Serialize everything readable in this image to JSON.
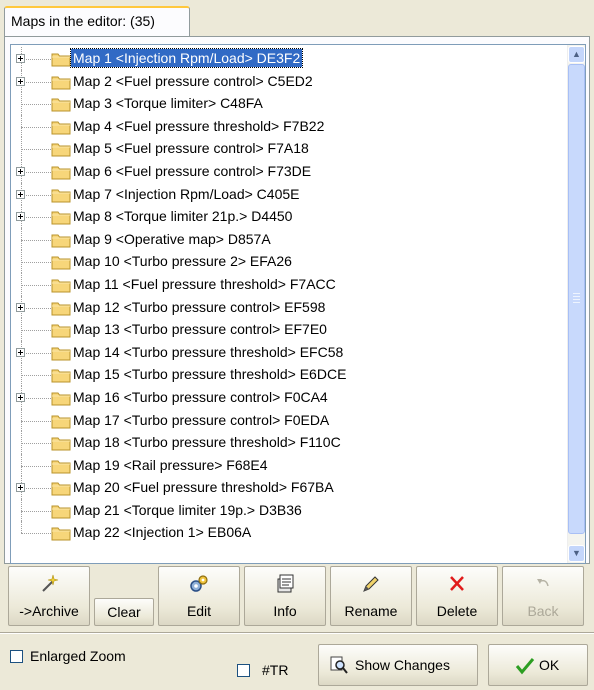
{
  "tab": {
    "label": "Maps in the editor: (35)"
  },
  "maps": [
    {
      "label": "Map 1 <Injection  Rpm/Load>  DE3F2",
      "expandable": true,
      "selected": true
    },
    {
      "label": "Map 2 <Fuel pressure control>  C5ED2",
      "expandable": true,
      "selected": false
    },
    {
      "label": "Map 3 <Torque limiter>  C48FA",
      "expandable": false,
      "selected": false
    },
    {
      "label": "Map 4 <Fuel pressure threshold>  F7B22",
      "expandable": false,
      "selected": false
    },
    {
      "label": "Map 5 <Fuel pressure control>  F7A18",
      "expandable": false,
      "selected": false
    },
    {
      "label": "Map 6 <Fuel pressure control>  F73DE",
      "expandable": true,
      "selected": false
    },
    {
      "label": "Map 7 <Injection  Rpm/Load>  C405E",
      "expandable": true,
      "selected": false
    },
    {
      "label": "Map 8 <Torque limiter 21p.>  D4450",
      "expandable": true,
      "selected": false
    },
    {
      "label": "Map 9 <Operative map>  D857A",
      "expandable": false,
      "selected": false
    },
    {
      "label": "Map 10 <Turbo pressure 2>  EFA26",
      "expandable": false,
      "selected": false
    },
    {
      "label": "Map 11 <Fuel pressure threshold>  F7ACC",
      "expandable": false,
      "selected": false
    },
    {
      "label": "Map 12 <Turbo pressure control>  EF598",
      "expandable": true,
      "selected": false
    },
    {
      "label": "Map 13 <Turbo pressure control>  EF7E0",
      "expandable": false,
      "selected": false
    },
    {
      "label": "Map 14 <Turbo pressure threshold>  EFC58",
      "expandable": true,
      "selected": false
    },
    {
      "label": "Map 15 <Turbo pressure threshold>  E6DCE",
      "expandable": false,
      "selected": false
    },
    {
      "label": "Map 16 <Turbo pressure control>  F0CA4",
      "expandable": true,
      "selected": false
    },
    {
      "label": "Map 17 <Turbo pressure control>  F0EDA",
      "expandable": false,
      "selected": false
    },
    {
      "label": "Map 18 <Turbo pressure threshold>  F110C",
      "expandable": false,
      "selected": false
    },
    {
      "label": "Map 19 <Rail pressure>  F68E4",
      "expandable": false,
      "selected": false
    },
    {
      "label": "Map 20 <Fuel pressure threshold>  F67BA",
      "expandable": true,
      "selected": false
    },
    {
      "label": "Map 21 <Torque limiter 19p.>  D3B36",
      "expandable": false,
      "selected": false
    },
    {
      "label": "Map 22 <Injection 1>  EB06A",
      "expandable": false,
      "selected": false
    }
  ],
  "toolbar": {
    "archive": "->Archive",
    "clear": "Clear",
    "edit": "Edit",
    "info": "Info",
    "rename": "Rename",
    "delete": "Delete",
    "back": "Back"
  },
  "icons": {
    "archive": "wand-icon",
    "edit": "gears-icon",
    "info": "info-icon",
    "rename": "pencil-icon",
    "delete": "red-x-icon",
    "back": "undo-icon",
    "show_changes": "magnifier-icon",
    "ok": "checkmark-icon",
    "folder": "folder-icon"
  },
  "options": {
    "enlarged_zoom": "Enlarged Zoom",
    "enlarged_zoom_checked": false,
    "tr": "#TR",
    "tr_checked": false
  },
  "buttons": {
    "show_changes": "Show Changes",
    "ok": "OK"
  },
  "colors": {
    "selection": "#316ac5",
    "folder": "#f7d67a",
    "delete": "#e11b1b",
    "ok": "#2c9e22"
  }
}
